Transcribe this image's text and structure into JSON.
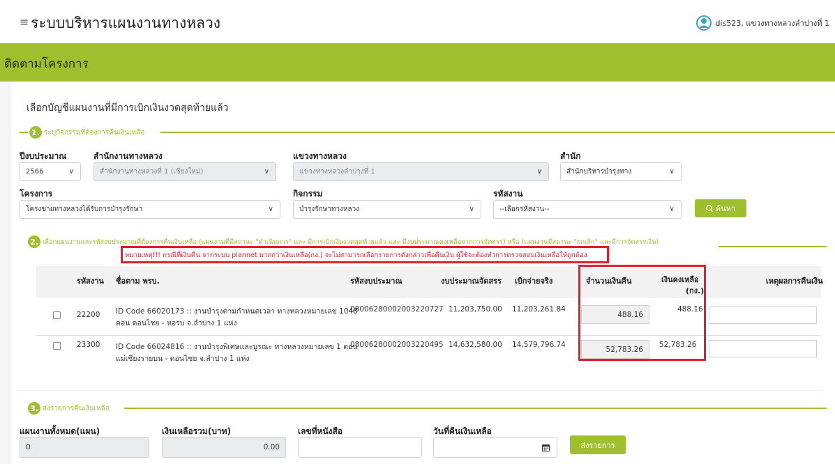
{
  "header": {
    "menu_icon": "hamburger-icon",
    "app_title": "ระบบบริหารแผนงานทางหลวง",
    "user_icon": "user-icon",
    "user_label": "dis523, แขวงทางหลวงลำปางที่ 1"
  },
  "page_title": "ติดตามโครงการ",
  "lead_text": "เลือกบัญชีแผนงานที่มีการเบิกเงินงวดสุดท้ายแล้ว",
  "section1": {
    "number": "1.",
    "title": "ระบุกิจกรรมที่ต้องการคืนเงินเหลือ",
    "fiscal_year": {
      "label": "ปีงบประมาณ",
      "value": "2566"
    },
    "highway_office": {
      "label": "สำนักงานทางหลวง",
      "value": "สำนักงานทางหลวงที่ 1 (เชียงใหม่)"
    },
    "highway_district": {
      "label": "แขวงทางหลวง",
      "value": "แขวงทางหลวงลำปางที่ 1"
    },
    "bureau": {
      "label": "สำนัก",
      "value": "สำนักบริหารบำรุงทาง"
    },
    "project": {
      "label": "โครงการ",
      "value": "โครงข่ายทางหลวงได้รับการบำรุงรักษา"
    },
    "activity": {
      "label": "กิจกรรม",
      "value": "บำรุงรักษาทางหลวง"
    },
    "work_code": {
      "label": "รหัสงาน",
      "value": "--เลือกรหัสงาน--"
    },
    "search_button": "ค้นหา",
    "search_icon": "search-icon"
  },
  "section2": {
    "number": "2.",
    "title": "เลือกแผนงานและรหัสงบประมาณที่ต้องการคืนเงินเหลือ (แผนงานที่มีสถานะ \"ดำเนินการ\" และ มีการเบิกเงินงวดสุดท้ายแล้ว และ มีงบประมาณคงเหลือจากการจัดสรร) หรือ (แผนงานมีสถานะ \"ยกเลิก\" และมีการจัดสรรเงิน)",
    "warning": "หมายเหตุ!!! กรณีที่เงินคืน จากระบบ plannet มากกว่าเงินเหลือ(กง.) จะไม่สามารถเลือกรายการดังกล่าวเพื่อคืนเงิน ผู้ใช้จะต้องทำการตรวจสอบเงินเหลือให้ถูกต้อง",
    "columns": {
      "code": "รหัสงาน",
      "name": "ชื่อตาม พรบ.",
      "budget_code": "รหัสงบประมาณ",
      "allocated": "งบประมาณจัดสรร",
      "paid": "เบิกจ่ายจริง",
      "refund": "จำนวนเงินคืน",
      "remaining": "เงินคงเหลือ",
      "remaining_unit": "(กง.)",
      "reason": "เหตุผลการคืนเงิน"
    },
    "rows": [
      {
        "code": "22200",
        "name_line1": "ID Code 66020173 :: งานบำรุงตามกำหนดเวลา ทางหลวงหมายเลข 1048",
        "name_line2": "ตอน ดอนไชย - หอรบ จ.ลำปาง 1 แห่ง",
        "budget_code": "08006280002003220727",
        "allocated": "11,203,750.00",
        "paid": "11,203,261.84",
        "refund": "488.16",
        "remaining": "488.16"
      },
      {
        "code": "23300",
        "name_line1": "ID Code 66024816 :: งานบำรุงพิเศษและบูรณะ ทางหลวงหมายเลข 1 ตอน",
        "name_line2": "แม่เชียงรายบน - ดอนไชย จ.ลำปาง 1 แห่ง",
        "budget_code": "08006280002003220495",
        "allocated": "14,632,580.00",
        "paid": "14,579,796.74",
        "refund": "52,783.26",
        "remaining": "52,783.26"
      }
    ]
  },
  "section3": {
    "number": "3.",
    "title": "ส่งรายการคืนเงินเหลือ",
    "total_plans": {
      "label": "แผนงานทั้งหมด(แผน)",
      "value": "0"
    },
    "total_remaining": {
      "label": "เงินเหลือรวม(บาท)",
      "value": "0.00"
    },
    "doc_no": {
      "label": "เลขที่หนังสือ",
      "value": ""
    },
    "refund_date": {
      "label": "วันที่คืนเงินเหลือ",
      "value": ""
    },
    "calendar_icon": "calendar-icon",
    "submit_button": "ส่งรายการ"
  },
  "colors": {
    "accent": "#9fbf2e",
    "warning": "#e11e2d"
  }
}
